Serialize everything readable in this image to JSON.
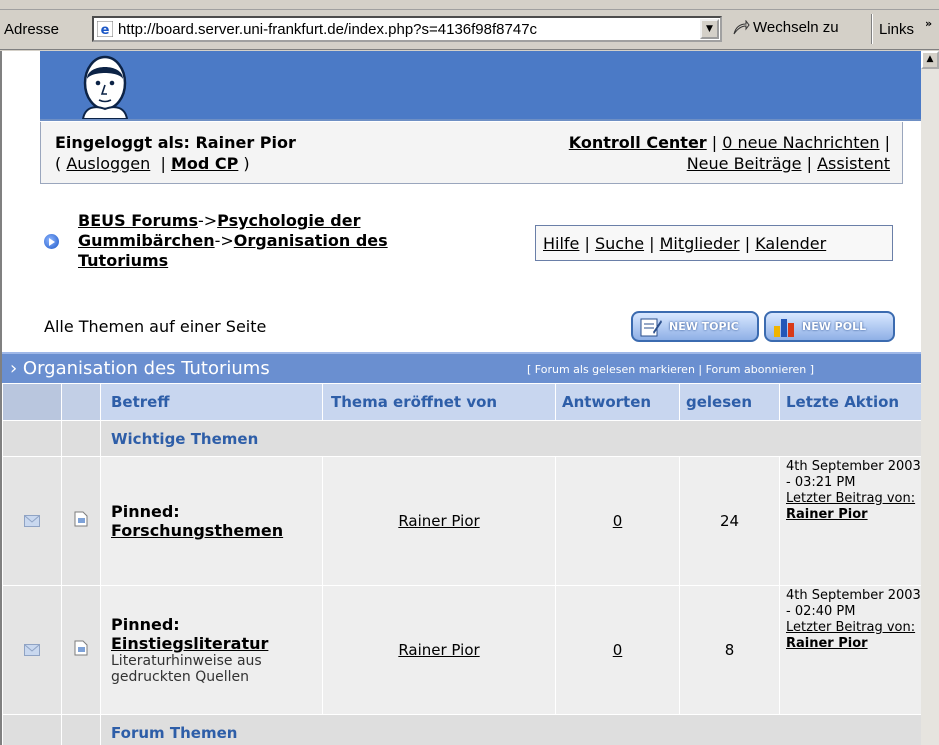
{
  "browser": {
    "address_label": "Adresse",
    "url": "http://board.server.uni-frankfurt.de/index.php?s=4136f98f8747c",
    "go_label": "Wechseln zu",
    "links_label": "Links",
    "chevron": "»"
  },
  "user_panel": {
    "logged_in": "Eingeloggt als: Rainer Pior",
    "logout": "Ausloggen",
    "mod_cp": "Mod CP",
    "control_center": "Kontroll Center",
    "new_messages": "0 neue Nachrichten",
    "new_posts": "Neue Beiträge",
    "assistant": "Assistent"
  },
  "breadcrumb": {
    "root": "BEUS Forums",
    "category": "Psychologie der Gummibärchen",
    "forum": "Organisation des Tutoriums",
    "sep": "->"
  },
  "nav": {
    "help": "Hilfe",
    "search": "Suche",
    "members": "Mitglieder",
    "calendar": "Kalender"
  },
  "toolbar": {
    "all_topics": "Alle Themen auf einer Seite",
    "new_topic": "NEW TOPIC",
    "new_poll": "NEW POLL"
  },
  "forum": {
    "title": "Organisation des Tutoriums",
    "options": "[ Forum als gelesen markieren | Forum abonnieren ]"
  },
  "table": {
    "headers": [
      "Betreff",
      "Thema eröffnet von",
      "Antworten",
      "gelesen",
      "Letzte Aktion"
    ],
    "section_important": "Wichtige Themen",
    "section_forum": "Forum Themen",
    "rows": [
      {
        "prefix": "Pinned:",
        "title": "Forschungsthemen",
        "description": "",
        "starter": "Rainer Pior",
        "replies": "0",
        "views": "24",
        "last_date": "4th September 2003 - 03:21 PM",
        "last_by_label": "Letzter Beitrag von:",
        "last_by_user": "Rainer Pior"
      },
      {
        "prefix": "Pinned:",
        "title": "Einstiegsliteratur",
        "description": "Literaturhinweise aus gedruckten Quellen",
        "starter": "Rainer Pior",
        "replies": "0",
        "views": "8",
        "last_date": "4th September 2003 - 02:40 PM",
        "last_by_label": "Letzter Beitrag von:",
        "last_by_user": "Rainer Pior"
      }
    ]
  }
}
